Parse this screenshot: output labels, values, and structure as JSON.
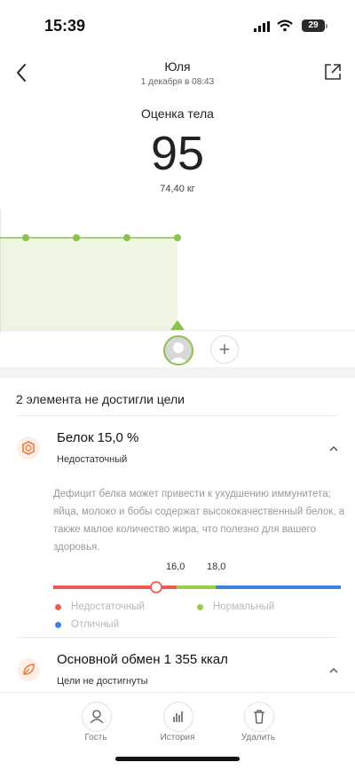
{
  "status_bar": {
    "time": "15:39",
    "battery": "29"
  },
  "header": {
    "name": "Юля",
    "date": "1 декабря в 08:43"
  },
  "score": {
    "label": "Оценка тела",
    "value": "95",
    "weight": "74,40 кг"
  },
  "chart_data": {
    "type": "area",
    "x": [
      1,
      2,
      3,
      4
    ],
    "series": [
      {
        "values": [
          95,
          95,
          95,
          95
        ]
      }
    ],
    "color": "#8bc34a",
    "fill": "#eef5e0",
    "grid": false
  },
  "section": {
    "title": "2 элемента не достигли цели"
  },
  "metrics": [
    {
      "title": "Белок 15,0 %",
      "status": "Недостаточный",
      "icon": "protein-icon",
      "description": "Дефицит белка может привести к ухудшению иммунитета; яйца, молоко и бобы содержат высококачественный белок, а также малое количество жира, что полезно для вашего здоровья.",
      "scale": {
        "thresholds": [
          "16,0",
          "18,0"
        ],
        "current": 15.0,
        "min": 10.0,
        "max": 24.0,
        "colors": [
          "#ef5a52",
          "#9ccc47",
          "#3f7fe0"
        ]
      },
      "legend": [
        {
          "label": "Недостаточный",
          "color": "#ef5a52"
        },
        {
          "label": "Нормальный",
          "color": "#9ccc47"
        },
        {
          "label": "Отличный",
          "color": "#3f7fe0"
        }
      ]
    },
    {
      "title": "Основной обмен 1 355 ккал",
      "status": "Цели не достигнуты",
      "icon": "leaf-icon"
    }
  ],
  "nav": {
    "guest": "Гость",
    "history": "История",
    "delete": "Удалить"
  }
}
